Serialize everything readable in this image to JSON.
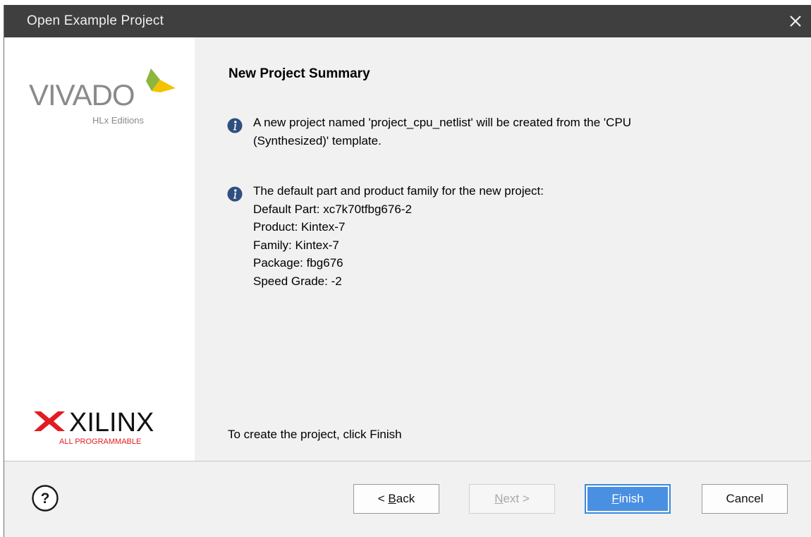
{
  "window": {
    "title": "Open Example Project"
  },
  "branding": {
    "vivado_text": "VIVADO",
    "vivado_sub": "HLx Editions",
    "xilinx_text": "XILINX",
    "xilinx_sub": "ALL PROGRAMMABLE"
  },
  "content": {
    "heading": "New Project Summary",
    "info1_lines": [
      "A new project named 'project_cpu_netlist' will be created from the 'CPU",
      "(Synthesized)' template."
    ],
    "info2_lines": [
      "The default part and product family for the new project:",
      "Default Part: xc7k70tfbg676-2",
      "Product: Kintex-7",
      "Family: Kintex-7",
      "Package: fbg676",
      "Speed Grade: -2"
    ],
    "footer_note": "To create the project, click Finish"
  },
  "buttons": {
    "back_prefix": "< ",
    "back_mnemonic": "B",
    "back_rest": "ack",
    "next_mnemonic": "N",
    "next_rest": "ext >",
    "finish_mnemonic": "F",
    "finish_rest": "inish",
    "cancel": "Cancel"
  },
  "colors": {
    "titlebar": "#3f3f3f",
    "content_bg": "#f1f1f1",
    "finish_blue": "#4a90e2",
    "info_icon": "#2f4f7f",
    "vivado_green": "#8cb63c",
    "vivado_yellow": "#f3c300",
    "xilinx_red": "#e31b23"
  },
  "icons": {
    "close": "close-icon",
    "info": "info-icon",
    "help": "help-icon"
  }
}
